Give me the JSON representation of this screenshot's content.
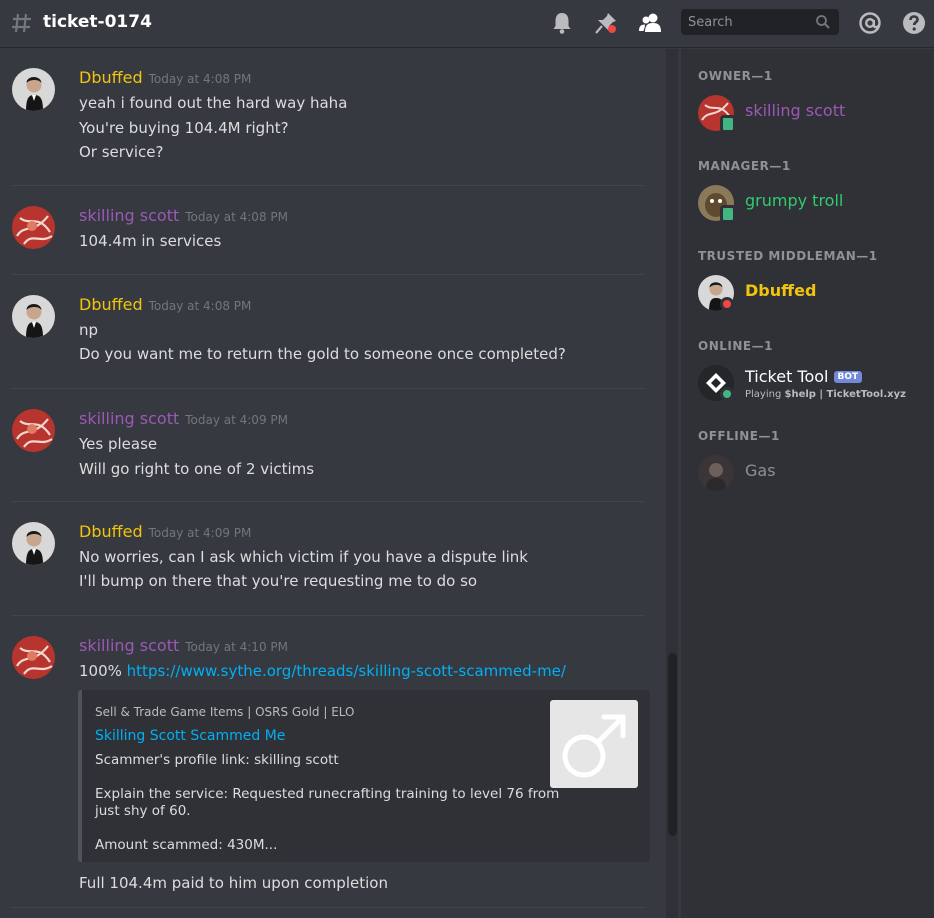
{
  "header": {
    "channel_name": "ticket-0174",
    "search_placeholder": "Search"
  },
  "colors": {
    "dbuffed": "#f1c40f",
    "skilling_scott": "#9b59b6",
    "grumpy_troll": "#2ecc71",
    "link": "#00b0f4"
  },
  "messages": [
    {
      "author": "Dbuffed",
      "timestamp": "Today at 4:08 PM",
      "lines": [
        "yeah i found out the hard way haha",
        "You're buying 104.4M right?",
        "Or service?"
      ]
    },
    {
      "author": "skilling scott",
      "timestamp": "Today at 4:08 PM",
      "lines": [
        "104.4m in services"
      ]
    },
    {
      "author": "Dbuffed",
      "timestamp": "Today at 4:08 PM",
      "lines": [
        "np",
        "Do you want me to return the gold to someone once completed?"
      ]
    },
    {
      "author": "skilling scott",
      "timestamp": "Today at 4:09 PM",
      "lines": [
        "Yes please",
        "Will go right to one of 2 victims"
      ]
    },
    {
      "author": "Dbuffed",
      "timestamp": "Today at 4:09 PM",
      "lines": [
        "No worries, can I ask which victim if you have a dispute link",
        "I'll bump on there that you're requesting me to do so"
      ]
    },
    {
      "author": "skilling scott",
      "timestamp": "Today at 4:10 PM",
      "prefix": "100%",
      "link": "https://www.sythe.org/threads/skilling-scott-scammed-me/",
      "after": "Full 104.4m paid to him upon completion"
    }
  ],
  "embed": {
    "provider": "Sell & Trade Game Items | OSRS Gold | ELO",
    "title": "Skilling Scott Scammed Me",
    "line1": "Scammer's profile link: skilling scott",
    "line2": "Explain the service: Requested runecrafting training to level 76 from",
    "line3": "just shy of 60.",
    "line4": "Amount scammed: 430M..."
  },
  "members": {
    "groups": [
      {
        "title": "OWNER—1",
        "name": "skilling scott"
      },
      {
        "title": "MANAGER—1",
        "name": "grumpy troll"
      },
      {
        "title": "TRUSTED MIDDLEMAN—1",
        "name": "Dbuffed"
      },
      {
        "title": "ONLINE—1",
        "name": "Ticket Tool",
        "tag": "BOT",
        "activity_prefix": "Playing ",
        "activity": "$help | TicketTool.xyz"
      },
      {
        "title": "OFFLINE—1",
        "name": "Gas"
      }
    ]
  },
  "icons": [
    "hash-icon",
    "bell-icon",
    "pin-icon",
    "members-icon",
    "search-icon",
    "mention-icon",
    "help-icon"
  ]
}
